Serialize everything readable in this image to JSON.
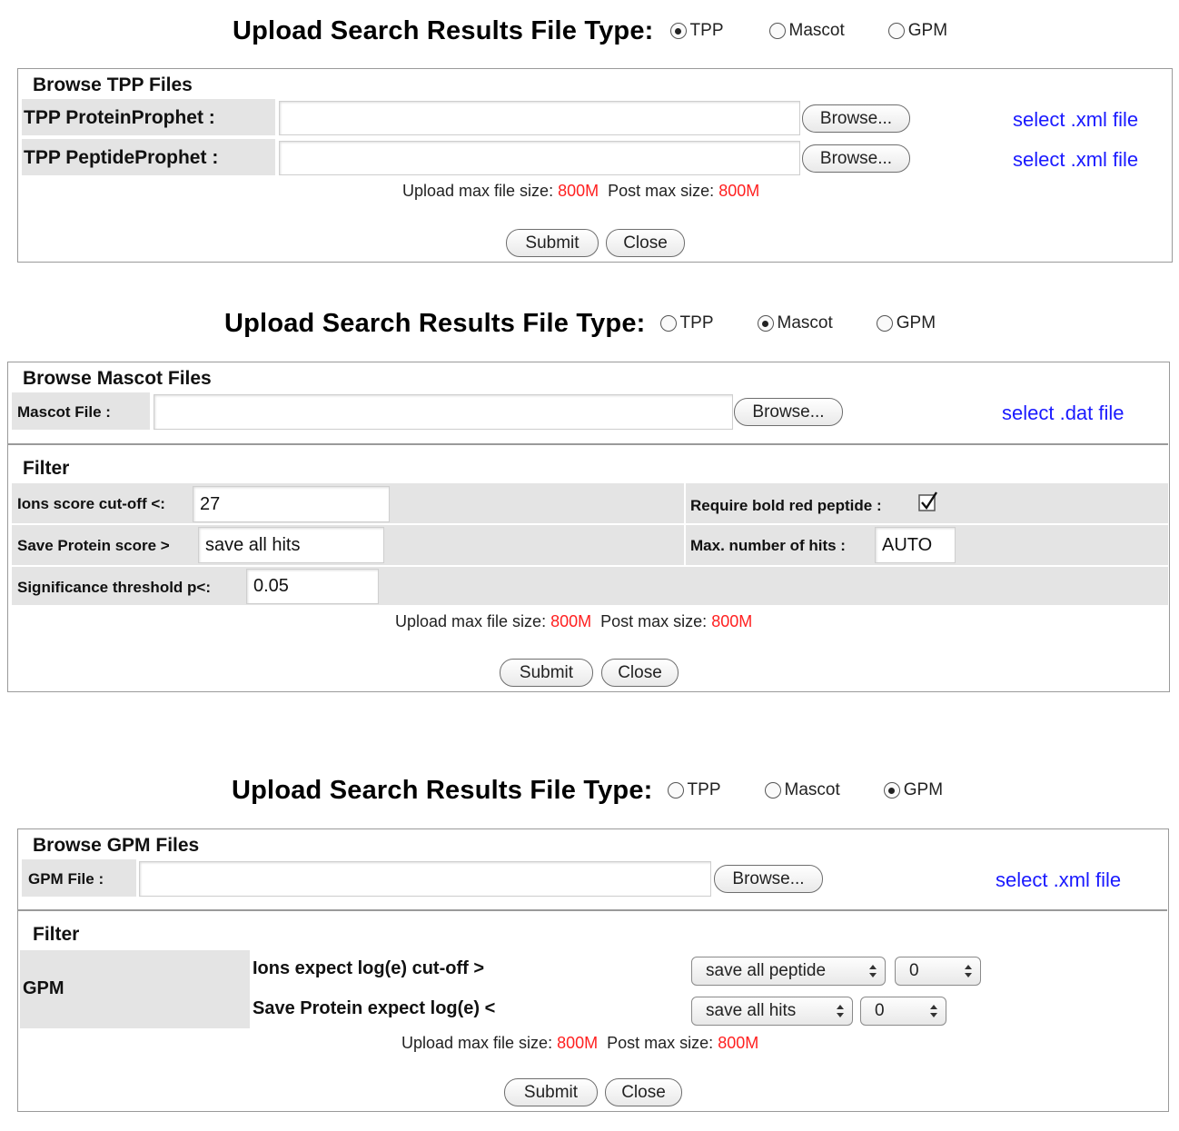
{
  "header_title": "Upload Search Results File Type:",
  "radio_options": [
    "TPP",
    "Mascot",
    "GPM"
  ],
  "selected": [
    "TPP",
    "Mascot",
    "GPM"
  ],
  "tpp": {
    "section_title": "Browse TPP Files",
    "protein_label": "TPP ProteinProphet :",
    "peptide_label": "TPP PeptideProphet :",
    "browse_label": "Browse...",
    "hint": "select .xml file"
  },
  "mascot": {
    "section_title": "Browse Mascot Files",
    "file_label": "Mascot File :",
    "browse_label": "Browse...",
    "hint": "select .dat file",
    "filter_title": "Filter",
    "ions_label": "Ions score cut-off <:",
    "ions_value": "27",
    "save_protein_label": "Save Protein score >",
    "save_protein_value": "save all hits",
    "significance_label": "Significance threshold p<:",
    "significance_value": "0.05",
    "bold_red_label": "Require bold red peptide :",
    "bold_red_checked": true,
    "max_hits_label": "Max. number of hits :",
    "max_hits_value": "AUTO"
  },
  "gpm": {
    "section_title": "Browse GPM Files",
    "file_label": "GPM File :",
    "browse_label": "Browse...",
    "hint": "select .xml file",
    "filter_title": "Filter",
    "gpm_label": "GPM",
    "ions_expect_label": "Ions expect log(e) cut-off >",
    "save_protein_label": "Save Protein expect log(e) <",
    "ions_select": "save all peptide",
    "ions_num": "0",
    "protein_select": "save all hits",
    "protein_num": "0"
  },
  "upload": {
    "upload_label": "Upload max file size:",
    "upload_value": "800M",
    "post_label": "Post max size:",
    "post_value": "800M"
  },
  "buttons": {
    "submit": "Submit",
    "close": "Close"
  },
  "colors": {
    "link": "#1a1aff",
    "limit": "#ff2020",
    "label_bg": "#e4e4e4",
    "border": "#9a9a9a"
  }
}
